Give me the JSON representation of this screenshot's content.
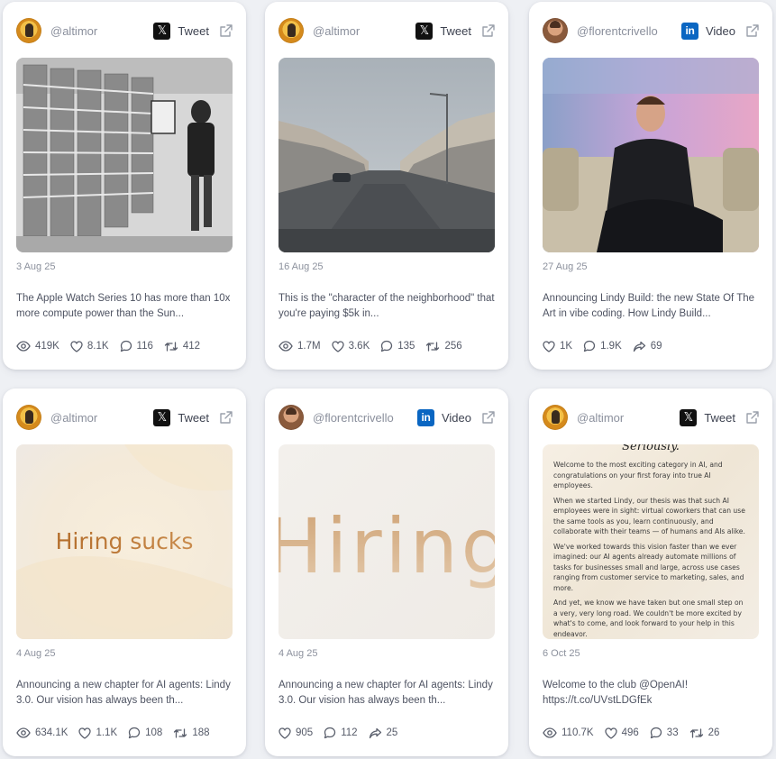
{
  "cards": [
    {
      "handle": "@altimor",
      "avatar": "altimor-avatar",
      "platform": "x",
      "platform_glyph": "𝕏",
      "type_label": "Tweet",
      "date": "3 Aug 25",
      "text": "The Apple Watch Series 10 has more than 10x more compute power than the Sun...",
      "stats": [
        {
          "icon": "eye-icon",
          "value": "419K"
        },
        {
          "icon": "heart-icon",
          "value": "8.1K"
        },
        {
          "icon": "comment-icon",
          "value": "116"
        },
        {
          "icon": "retweet-icon",
          "value": "412"
        }
      ]
    },
    {
      "handle": "@altimor",
      "avatar": "altimor-avatar",
      "platform": "x",
      "platform_glyph": "𝕏",
      "type_label": "Tweet",
      "date": "16 Aug 25",
      "text": "This is the \"character of the neighborhood\" that you're paying $5k in...",
      "stats": [
        {
          "icon": "eye-icon",
          "value": "1.7M"
        },
        {
          "icon": "heart-icon",
          "value": "3.6K"
        },
        {
          "icon": "comment-icon",
          "value": "135"
        },
        {
          "icon": "retweet-icon",
          "value": "256"
        }
      ]
    },
    {
      "handle": "@florentcrivello",
      "avatar": "florent-avatar",
      "platform": "linkedin",
      "platform_glyph": "in",
      "type_label": "Video",
      "date": "27 Aug 25",
      "text": "Announcing Lindy Build: the new State Of The Art in vibe coding. How Lindy Build...",
      "stats": [
        {
          "icon": "heart-icon",
          "value": "1K"
        },
        {
          "icon": "comment-icon",
          "value": "1.9K"
        },
        {
          "icon": "share-icon",
          "value": "69"
        }
      ]
    },
    {
      "handle": "@altimor",
      "avatar": "altimor-avatar",
      "platform": "x",
      "platform_glyph": "𝕏",
      "type_label": "Tweet",
      "date": "4 Aug 25",
      "text": "Announcing a new chapter for AI agents: Lindy 3.0. Our vision has always been th...",
      "media_text": "Hiring sucks",
      "stats": [
        {
          "icon": "eye-icon",
          "value": "634.1K"
        },
        {
          "icon": "heart-icon",
          "value": "1.1K"
        },
        {
          "icon": "comment-icon",
          "value": "108"
        },
        {
          "icon": "retweet-icon",
          "value": "188"
        }
      ]
    },
    {
      "handle": "@florentcrivello",
      "avatar": "florent-avatar",
      "platform": "linkedin",
      "platform_glyph": "in",
      "type_label": "Video",
      "date": "4 Aug 25",
      "text": "Announcing a new chapter for AI agents: Lindy 3.0. Our vision has always been th...",
      "media_text": "Hiring",
      "stats": [
        {
          "icon": "heart-icon",
          "value": "905"
        },
        {
          "icon": "comment-icon",
          "value": "112"
        },
        {
          "icon": "share-icon",
          "value": "25"
        }
      ]
    },
    {
      "handle": "@altimor",
      "avatar": "altimor-avatar",
      "platform": "x",
      "platform_glyph": "𝕏",
      "type_label": "Tweet",
      "date": "6 Oct 25",
      "text": "Welcome to the club @OpenAI! https://t.co/UVstLDGfEk",
      "media_doc": {
        "heading": "Seriously.",
        "paragraphs": [
          "Welcome to the most exciting category in AI, and congratulations on your first foray into true AI employees.",
          "When we started Lindy, our thesis was that such AI employees were in sight: virtual coworkers that can use the same tools as you, learn continuously, and collaborate with their teams — of humans and AIs alike.",
          "We've worked towards this vision faster than we ever imagined: our AI agents already automate millions of tasks for businesses small and large, across use cases ranging from customer service to marketing, sales, and more.",
          "And yet, we know we have taken but one small step on a very, very long road. We couldn't be more excited by what's to come, and look forward to your help in this endeavor."
        ]
      },
      "stats": [
        {
          "icon": "eye-icon",
          "value": "110.7K"
        },
        {
          "icon": "heart-icon",
          "value": "496"
        },
        {
          "icon": "comment-icon",
          "value": "33"
        },
        {
          "icon": "retweet-icon",
          "value": "26"
        }
      ]
    }
  ],
  "colors": {
    "background": "#eef0f4",
    "card": "#ffffff",
    "x_badge": "#111111",
    "linkedin_badge": "#0a66c2",
    "muted_text": "#8a8f9c"
  }
}
